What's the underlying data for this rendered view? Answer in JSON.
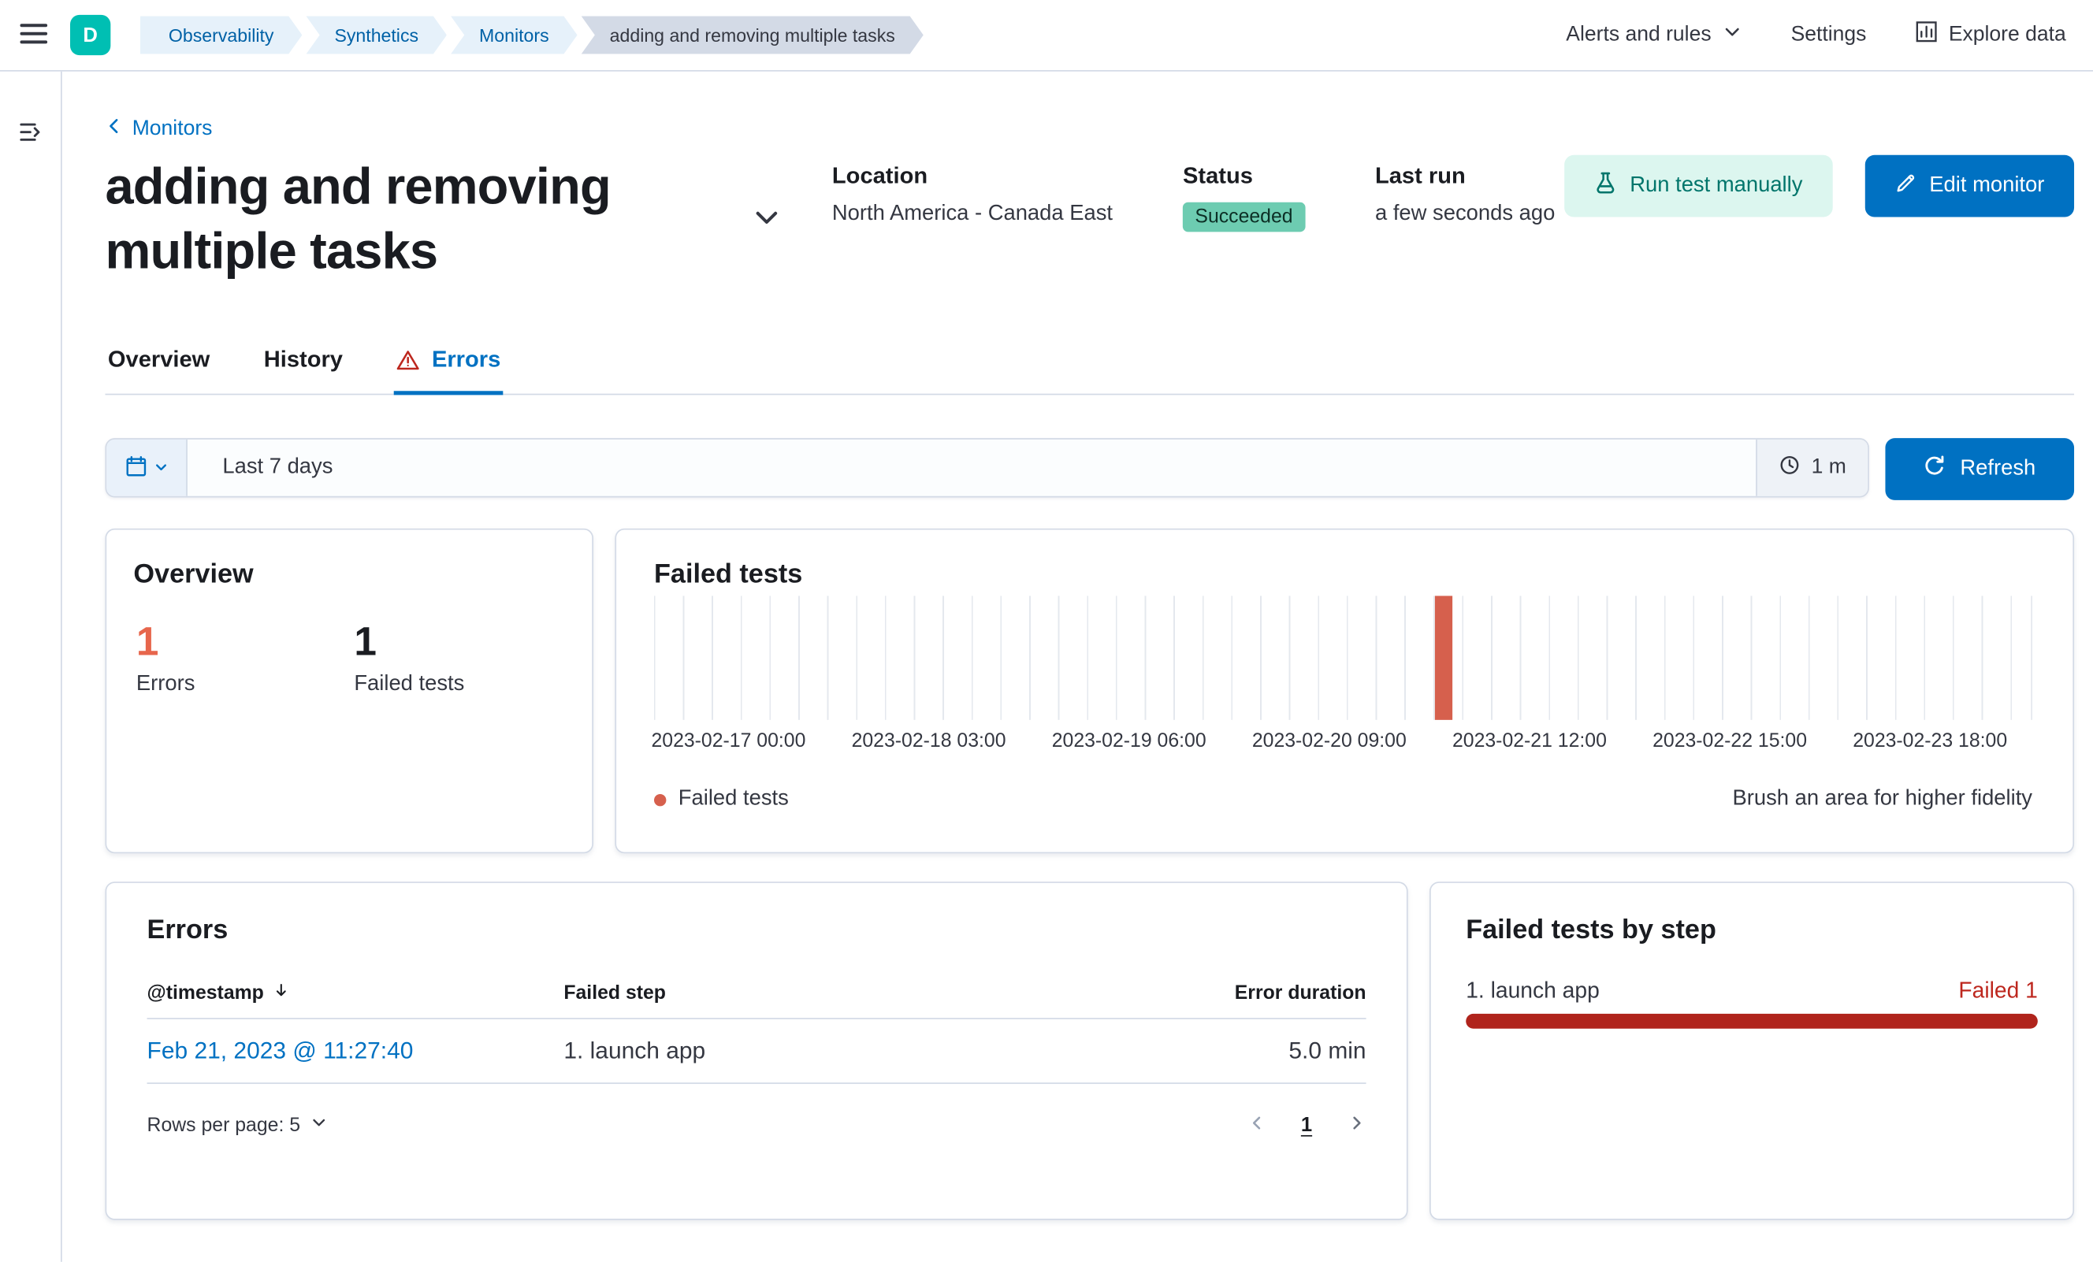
{
  "colors": {
    "primary_blue": "#0071c2",
    "deployment_teal": "#00bfb3",
    "success_badge_green": "#6dccb1",
    "danger_red": "#bd271e",
    "chart_bar_red": "#d6604d",
    "errors_count_red": "#e7664c"
  },
  "topbar": {
    "deployment_initial": "D",
    "breadcrumbs": [
      "Observability",
      "Synthetics",
      "Monitors",
      "adding and removing multiple tasks"
    ],
    "alerts_menu": "Alerts and rules",
    "settings": "Settings",
    "explore_data": "Explore data"
  },
  "monitor": {
    "back_link": "Monitors",
    "title": "adding and removing multiple tasks",
    "location_label": "Location",
    "location_value": "North America - Canada East",
    "status_label": "Status",
    "status_value": "Succeeded",
    "last_run_label": "Last run",
    "last_run_value": "a few seconds ago",
    "run_test_button": "Run test manually",
    "edit_button": "Edit monitor"
  },
  "tabs": {
    "overview": "Overview",
    "history": "History",
    "errors": "Errors"
  },
  "time_controls": {
    "range": "Last 7 days",
    "refresh_interval": "1 m",
    "refresh_button": "Refresh"
  },
  "overview_panel": {
    "title": "Overview",
    "errors_count": "1",
    "errors_label": "Errors",
    "failed_tests_count": "1",
    "failed_tests_label": "Failed tests"
  },
  "failed_tests_panel": {
    "title": "Failed tests",
    "legend_label": "Failed tests",
    "brush_hint": "Brush an area for higher fidelity"
  },
  "chart_data": {
    "type": "bar",
    "title": "Failed tests",
    "x_ticks": [
      "2023-02-17 00:00",
      "2023-02-18 03:00",
      "2023-02-19 06:00",
      "2023-02-20 09:00",
      "2023-02-21 12:00",
      "2023-02-22 15:00",
      "2023-02-23 18:00"
    ],
    "series": [
      {
        "name": "Failed tests",
        "points": [
          {
            "x": "2023-02-21 06:00",
            "y": 1
          }
        ]
      }
    ],
    "ylim": [
      0,
      1
    ],
    "grid": "vertical",
    "legend_position": "bottom-left",
    "annotation": "Brush an area for higher fidelity"
  },
  "errors_panel": {
    "title": "Errors",
    "columns": {
      "timestamp": "@timestamp",
      "failed_step": "Failed step",
      "error_duration": "Error duration"
    },
    "rows": [
      {
        "timestamp": "Feb 21, 2023 @ 11:27:40",
        "failed_step": "1. launch app",
        "error_duration": "5.0 min"
      }
    ],
    "rows_per_page": "Rows per page: 5",
    "current_page": "1"
  },
  "failed_by_step_panel": {
    "title": "Failed tests by step",
    "step_label": "1. launch app",
    "failed_badge": "Failed 1"
  }
}
